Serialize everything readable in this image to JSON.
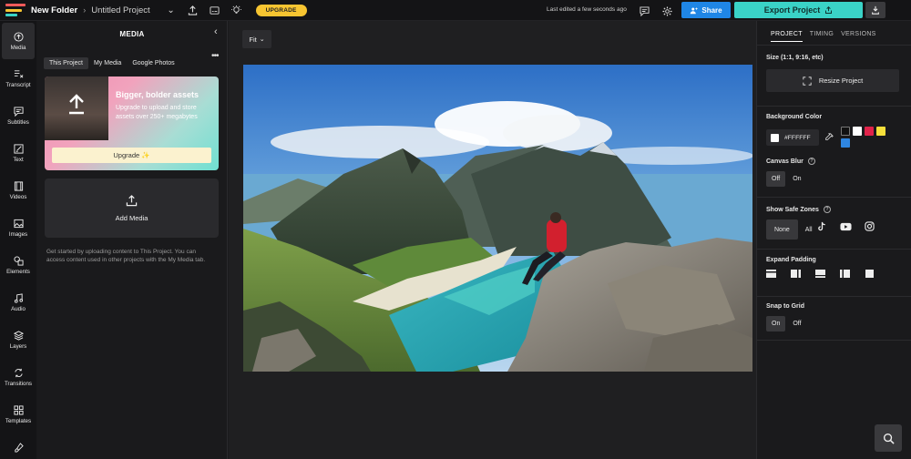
{
  "header": {
    "folder": "New Folder",
    "project": "Untitled Project",
    "upgrade": "UPGRADE",
    "last_edited": "Last edited a few seconds ago",
    "share": "Share",
    "export": "Export Project"
  },
  "rail": {
    "items": [
      {
        "label": "Media",
        "icon": "media-icon"
      },
      {
        "label": "Transcript",
        "icon": "transcript-icon"
      },
      {
        "label": "Subtitles",
        "icon": "subtitles-icon"
      },
      {
        "label": "Text",
        "icon": "text-icon"
      },
      {
        "label": "Videos",
        "icon": "videos-icon"
      },
      {
        "label": "Images",
        "icon": "images-icon"
      },
      {
        "label": "Elements",
        "icon": "elements-icon"
      },
      {
        "label": "Audio",
        "icon": "audio-icon"
      },
      {
        "label": "Layers",
        "icon": "layers-icon"
      },
      {
        "label": "Transitions",
        "icon": "transitions-icon"
      },
      {
        "label": "Templates",
        "icon": "templates-icon"
      }
    ]
  },
  "media": {
    "title": "MEDIA",
    "tabs": [
      "This Project",
      "My Media",
      "Google Photos"
    ],
    "promo_heading": "Bigger, bolder assets",
    "promo_text": "Upgrade to upload and store assets over 250+ megabytes",
    "promo_button": "Upgrade ✨",
    "add_media": "Add Media",
    "help_text": "Get started by uploading content to This Project. You can access content used in other projects with the My Media tab."
  },
  "canvas": {
    "fit": "Fit"
  },
  "right_panel": {
    "tabs": [
      "PROJECT",
      "TIMING",
      "VERSIONS"
    ],
    "size_label": "Size (1:1, 9:16, etc)",
    "resize_button": "Resize Project",
    "bg_label": "Background Color",
    "bg_value": "#FFFFFF",
    "swatches": [
      "#111111",
      "#ffffff",
      "#e0234a",
      "#f6e03b",
      "#2f86e0"
    ],
    "blur_label": "Canvas Blur",
    "blur_options": [
      "Off",
      "On"
    ],
    "safe_label": "Show Safe Zones",
    "safe_options": [
      "None",
      "All"
    ],
    "padding_label": "Expand Padding",
    "grid_label": "Snap to Grid",
    "grid_options": [
      "On",
      "Off"
    ]
  }
}
